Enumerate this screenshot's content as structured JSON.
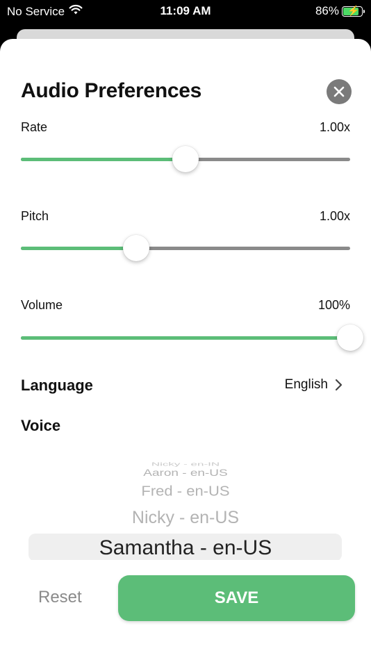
{
  "status_bar": {
    "carrier": "No Service",
    "time": "11:09 AM",
    "battery": "86%",
    "battery_level": 0.86
  },
  "sheet": {
    "title": "Audio Preferences"
  },
  "sliders": {
    "rate": {
      "label": "Rate",
      "value": "1.00x",
      "fraction": 0.5
    },
    "pitch": {
      "label": "Pitch",
      "value": "1.00x",
      "fraction": 0.35
    },
    "volume": {
      "label": "Volume",
      "value": "100%",
      "fraction": 1.0
    }
  },
  "language": {
    "label": "Language",
    "value": "English"
  },
  "voice": {
    "label": "Voice",
    "options": [
      "Nicky - en-IN",
      "Aaron - en-US",
      "Fred - en-US",
      "Nicky - en-US",
      "Samantha - en-US"
    ],
    "selected": "Samantha - en-US"
  },
  "buttons": {
    "reset": "Reset",
    "save": "SAVE"
  },
  "colors": {
    "accent": "#5cbd78",
    "track": "#8a8a8a",
    "close": "#7a7a7a"
  }
}
